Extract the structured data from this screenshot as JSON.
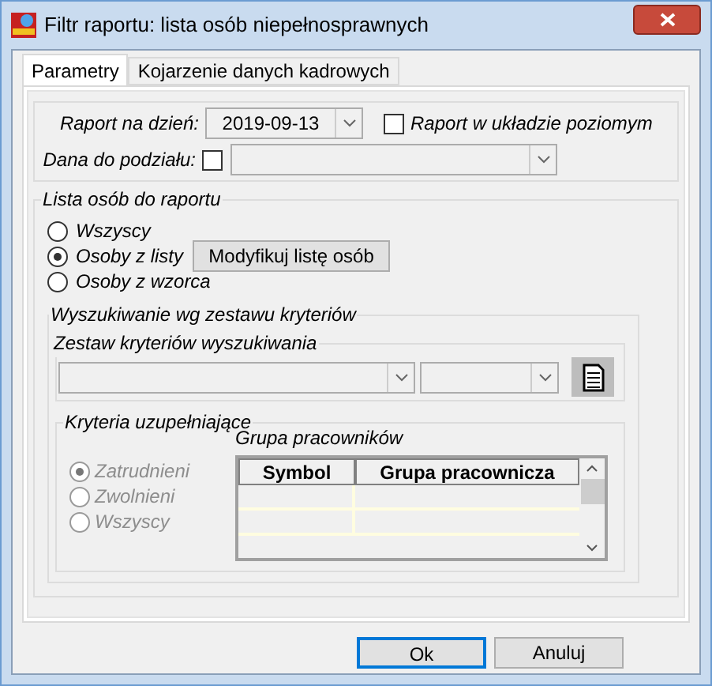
{
  "window": {
    "title": "Filtr raportu: lista osób niepełnosprawnych"
  },
  "tabs": [
    {
      "label": "Parametry",
      "selected": true
    },
    {
      "label": "Kojarzenie danych kadrowych",
      "selected": false
    }
  ],
  "report_date": {
    "label": "Raport na dzień:",
    "value": "2019-09-13"
  },
  "horizontal": {
    "label": "Raport w układzie poziomym",
    "checked": false
  },
  "split": {
    "label": "Dana do podziału:",
    "checked": false
  },
  "person_list": {
    "legend": "Lista osób do raportu",
    "options": [
      {
        "label": "Wszyscy",
        "selected": false
      },
      {
        "label": "Osoby z listy",
        "selected": true
      },
      {
        "label": "Osoby z wzorca",
        "selected": false
      }
    ],
    "modify_button": "Modyfikuj listę osób"
  },
  "search": {
    "legend": "Wyszukiwanie wg zestawu kryteriów",
    "set_legend": "Zestaw kryteriów wyszukiwania"
  },
  "supplementary": {
    "legend": "Kryteria uzupełniające",
    "disabled": true,
    "options": [
      {
        "label": "Zatrudnieni",
        "selected": true
      },
      {
        "label": "Zwolnieni",
        "selected": false
      },
      {
        "label": "Wszyscy",
        "selected": false
      }
    ],
    "group": {
      "title": "Grupa pracowników",
      "columns": [
        "Symbol",
        "Grupa pracownicza"
      ]
    }
  },
  "buttons": [
    {
      "label": "Ok",
      "default": true
    },
    {
      "label": "Anuluj",
      "default": false
    }
  ]
}
